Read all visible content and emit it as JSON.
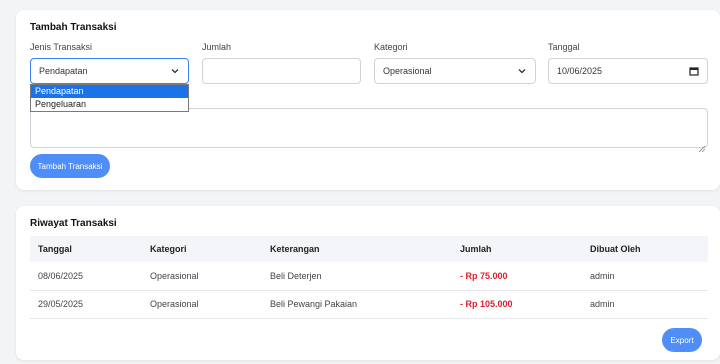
{
  "form": {
    "title": "Tambah Transaksi",
    "type_label": "Jenis Transaksi",
    "type_value": "Pendapatan",
    "type_options": [
      "Pendapatan",
      "Pengeluaran"
    ],
    "amount_label": "Jumlah",
    "amount_value": "",
    "category_label": "Kategori",
    "category_value": "Operasional",
    "date_label": "Tanggal",
    "date_value": "10/06/2025",
    "description_value": "",
    "submit_label": "Tambah Transaksi"
  },
  "history": {
    "title": "Riwayat Transaksi",
    "columns": [
      "Tanggal",
      "Kategori",
      "Keterangan",
      "Jumlah",
      "Dibuat Oleh"
    ],
    "rows": [
      [
        "08/06/2025",
        "Operasional",
        "Beli Deterjen",
        "- Rp 75.000",
        "admin"
      ],
      [
        "29/05/2025",
        "Operasional",
        "Beli Pewangi Pakaian",
        "- Rp 105.000",
        "admin"
      ]
    ],
    "export_label": "Export"
  },
  "colors": {
    "accent": "#4f8ef7",
    "negative": "#e11d2a",
    "selected": "#1a73e8"
  },
  "icons": {
    "select": "chevron-down-icon",
    "date": "calendar-icon",
    "textarea": "resize-handle-icon"
  }
}
